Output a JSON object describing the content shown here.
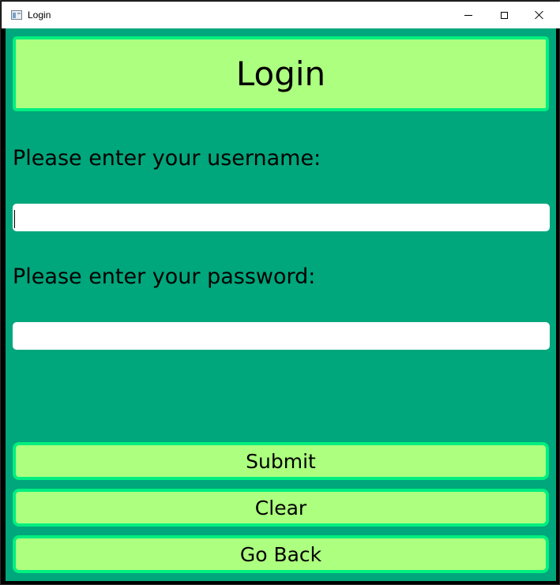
{
  "window": {
    "title": "Login",
    "controls": {
      "minimize": "minimize-icon",
      "maximize": "maximize-icon",
      "close": "close-icon"
    }
  },
  "header": {
    "title": "Login"
  },
  "form": {
    "username_prompt": "Please enter your username:",
    "username_value": "",
    "password_prompt": "Please enter your password:",
    "password_value": ""
  },
  "actions": {
    "submit_label": "Submit",
    "clear_label": "Clear",
    "back_label": "Go Back"
  },
  "colors": {
    "background": "#00a67c",
    "panel_fill": "#adff7f",
    "panel_border": "#00ef80",
    "field_fill": "#ffffff"
  }
}
